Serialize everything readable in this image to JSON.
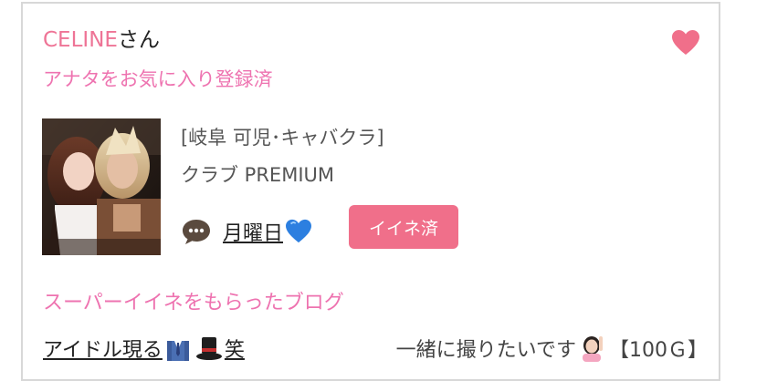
{
  "card": {
    "user_name": "CELINE",
    "user_suffix": "さん",
    "favorite_icon": "heart-icon",
    "favorite_status": "アナタをお気に入り登録済",
    "area": "[岐阜 可児･キャバクラ]",
    "shop_name": "クラブ PREMIUM",
    "comment_icon": "speech-bubble-icon",
    "comment_text": "月曜日",
    "comment_emoji": "blue-heart-icon",
    "iine_label": "イイネ済",
    "blog_heading": "スーパーイイネをもらったブログ",
    "blog_title_prefix": "アイドル現る",
    "blog_title_icons": [
      "suit-icon",
      "top-hat-icon"
    ],
    "blog_title_suffix": "笑",
    "blog_snippet_text": "一緒に撮りたいです",
    "blog_snippet_emoji": "person-raising-hand-icon",
    "blog_snippet_points": "【100Ｇ】",
    "colors": {
      "pink_text": "#ee7496",
      "magenta_text": "#ee73b0",
      "badge_bg": "#f06f8a",
      "heart": "#f06f8a",
      "blue_heart": "#2c7fe0"
    }
  }
}
